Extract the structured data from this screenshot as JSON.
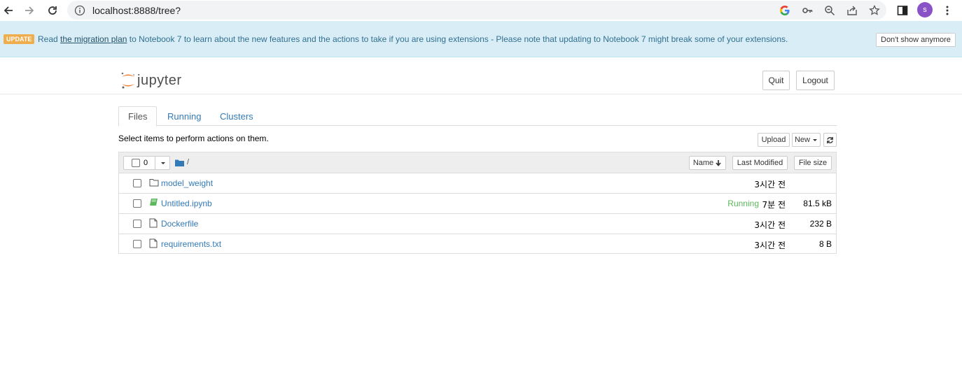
{
  "browser": {
    "url": "localhost:8888/tree?",
    "avatar_letter": "s",
    "icons": [
      "back-icon",
      "forward-icon",
      "reload-icon",
      "info-icon",
      "google-icon",
      "key-icon",
      "zoom-icon",
      "share-icon",
      "star-icon",
      "sidepanel-icon",
      "menu-icon"
    ]
  },
  "banner": {
    "badge": "UPDATE",
    "text_before": "Read",
    "link": "the migration plan",
    "text_after": "to Notebook 7 to learn about the new features and the actions to take if you are using extensions - Please note that updating to Notebook 7 might break some of your extensions.",
    "dismiss": "Don't show anymore"
  },
  "header": {
    "logo_text": "jupyter",
    "quit": "Quit",
    "logout": "Logout"
  },
  "tabs": [
    {
      "label": "Files",
      "active": true
    },
    {
      "label": "Running",
      "active": false
    },
    {
      "label": "Clusters",
      "active": false
    }
  ],
  "toolbar": {
    "select_msg": "Select items to perform actions on them.",
    "upload": "Upload",
    "new": "New",
    "refresh_icon": "refresh-icon"
  },
  "list_header": {
    "count": "0",
    "path": "/",
    "name": "Name",
    "last_modified": "Last Modified",
    "file_size": "File size"
  },
  "files": [
    {
      "name": "model_weight",
      "type": "folder",
      "status": "",
      "modified": "3시간 전",
      "size": ""
    },
    {
      "name": "Untitled.ipynb",
      "type": "notebook",
      "status": "Running",
      "modified": "7분 전",
      "size": "81.5 kB"
    },
    {
      "name": "Dockerfile",
      "type": "file",
      "status": "",
      "modified": "3시간 전",
      "size": "232 B"
    },
    {
      "name": "requirements.txt",
      "type": "file",
      "status": "",
      "modified": "3시간 전",
      "size": "8 B"
    }
  ],
  "colors": {
    "link": "#337ab7",
    "banner_bg": "#d9edf7",
    "banner_text": "#31708f",
    "badge": "#f0ad4e",
    "running": "#5cb85c",
    "avatar": "#8a52c7",
    "logo_orange": "#f37726"
  }
}
